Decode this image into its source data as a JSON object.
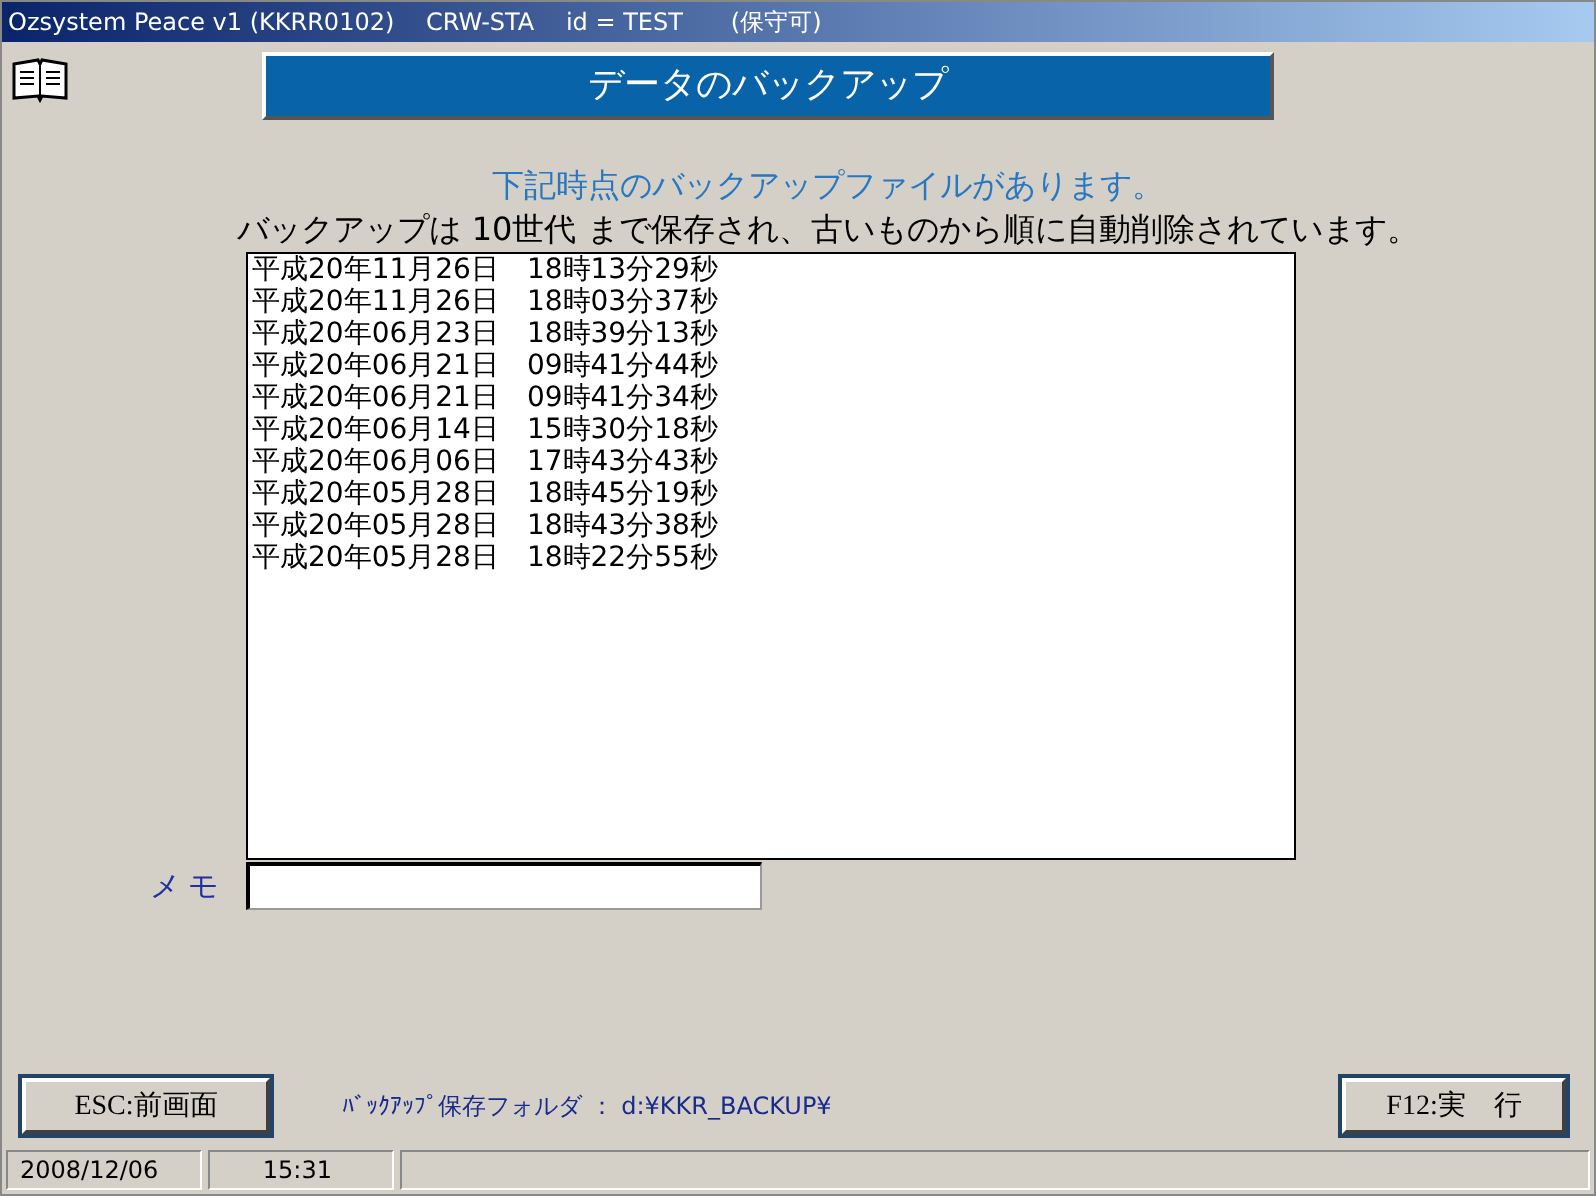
{
  "window": {
    "title": "Ozsystem Peace v1 (KKRR0102)　 CRW-STA　 id = TEST　　(保守可)"
  },
  "header": {
    "title": "データのバックアップ"
  },
  "messages": [
    "下記時点のバックアップファイルがあります。",
    "バックアップは 10世代 まで保存され、古いものから順に自動削除されています。"
  ],
  "backups": [
    {
      "label": "平成20年11月26日　18時13分29秒",
      "selected": false
    },
    {
      "label": "平成20年11月26日　18時03分37秒",
      "selected": false
    },
    {
      "label": "平成20年06月23日　18時39分13秒",
      "selected": false
    },
    {
      "label": "平成20年06月21日　09時41分44秒",
      "selected": false
    },
    {
      "label": "平成20年06月21日　09時41分34秒",
      "selected": false
    },
    {
      "label": "平成20年06月14日　15時30分18秒",
      "selected": false
    },
    {
      "label": "平成20年06月06日　17時43分43秒",
      "selected": false
    },
    {
      "label": "平成20年05月28日　18時45分19秒",
      "selected": false
    },
    {
      "label": "平成20年05月28日　18時43分38秒",
      "selected": false
    },
    {
      "label": "平成20年05月28日　18時22分55秒",
      "selected": false
    }
  ],
  "memo": {
    "label": "メモ"
  },
  "footer": {
    "back_button": "ESC:前画面",
    "folder": "ﾊﾞｯｸｱｯﾌﾟ保存フォルダ ： d:¥KKR_BACKUP¥",
    "run_button": "F12:実　行"
  },
  "status_bar": {
    "date": "2008/12/06",
    "time": "15:31"
  }
}
